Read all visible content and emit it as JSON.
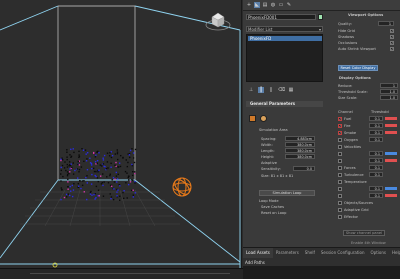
{
  "colors": {
    "accent": "#3f6ea3",
    "selection_cyan": "#8fd3f0",
    "emitter_orange": "#e87a1a",
    "particles_blue": "#2a2ae0",
    "fuel_red": "#e05050",
    "velocity_blue": "#4a8ae0"
  },
  "viewport": {
    "cube_label": "LEFT"
  },
  "command_panel": {
    "icons": [
      "create-icon",
      "modify-icon",
      "hierarchy-icon",
      "motion-icon",
      "display-icon",
      "utilities-icon"
    ],
    "object_name": "PhoenixFD001",
    "modifier_list": "Modifier List",
    "stack_item": "PhoenixFD",
    "stack_toolbar_icons": [
      "pin-stack-icon",
      "show-end-result-icon",
      "make-unique-icon",
      "remove-modifier-icon",
      "configure-sets-icon"
    ]
  },
  "general_parameters": {
    "header": "General Parameters",
    "simulation_area_label": "Simulation Area",
    "fields": [
      {
        "label": "Spacing:",
        "value": "4.883cm"
      },
      {
        "label": "Width:",
        "value": "380.0cm"
      },
      {
        "label": "Length:",
        "value": "380.0cm"
      },
      {
        "label": "Height:",
        "value": "380.0cm"
      }
    ],
    "adaptive_label": "Adaptive",
    "sensitivity_label": "Sensitivity:",
    "sensitivity_value": "0.0",
    "size_label": "Size: 81 x 81 x 81",
    "simulation_loop_label": "Simulation Loop",
    "loop_mode_label": "Loop Mode",
    "save_caches_label": "Save Caches",
    "reset_on_loop_label": "Reset on Loop"
  },
  "viewport_options": {
    "header": "Viewport Options",
    "quality_label": "Quality:",
    "quality_value": "1",
    "options": [
      {
        "label": "Hide Grid",
        "checked": true
      },
      {
        "label": "Shadows",
        "checked": true
      },
      {
        "label": "Occlusions",
        "checked": true
      },
      {
        "label": "Auto Shrink Viewport",
        "checked": true
      }
    ],
    "reset_button": "Reset Color Display"
  },
  "display_options": {
    "header": "Display Options",
    "fields": [
      {
        "label": "Reduce:",
        "value": "1"
      },
      {
        "label": "Threshold Scale:",
        "value": "1.0"
      },
      {
        "label": "Size Scale:",
        "value": "1.0"
      }
    ]
  },
  "channels": {
    "channel_header": "Channel",
    "threshold_header": "Threshold",
    "rows": [
      {
        "label": "Fuel",
        "checked": true,
        "value": "0.1",
        "color": "#e05050"
      },
      {
        "label": "Fire",
        "checked": true,
        "value": "0.1",
        "color": "#e05050"
      },
      {
        "label": "Smoke",
        "checked": true,
        "value": "0.1",
        "color": "#e05050"
      },
      {
        "label": "Oxygen",
        "checked": false,
        "value": "0.1",
        "color": ""
      },
      {
        "label": "Velocities",
        "checked": false,
        "value": "",
        "color": ""
      },
      {
        "label": "",
        "checked": false,
        "value": "0.1",
        "color": "#4a8ae0"
      },
      {
        "label": "",
        "checked": false,
        "value": "0.1",
        "color": "#e05050"
      },
      {
        "label": "Forces",
        "checked": false,
        "value": "0.1",
        "color": ""
      },
      {
        "label": "Turbulence",
        "checked": false,
        "value": "0.1",
        "color": ""
      },
      {
        "label": "Temperature",
        "checked": false,
        "value": "",
        "color": ""
      },
      {
        "label": "",
        "checked": false,
        "value": "0.1",
        "color": "#4a8ae0"
      },
      {
        "label": "",
        "checked": false,
        "value": "0.1",
        "color": "#e05050"
      },
      {
        "label": "Objects/Sources",
        "checked": false,
        "value": "",
        "color": ""
      },
      {
        "label": "Adaptive Grid",
        "checked": false,
        "value": "",
        "color": ""
      },
      {
        "label": "Effector",
        "checked": false,
        "value": "",
        "color": ""
      }
    ],
    "custom_button": "Show channel panel",
    "footer": "Enable 4th Window"
  },
  "bottom": {
    "tabs": [
      "Load Assets",
      "Parameters",
      "Shelf",
      "Session Configuration",
      "Options",
      "Help"
    ],
    "add_path": "Add Paths"
  }
}
